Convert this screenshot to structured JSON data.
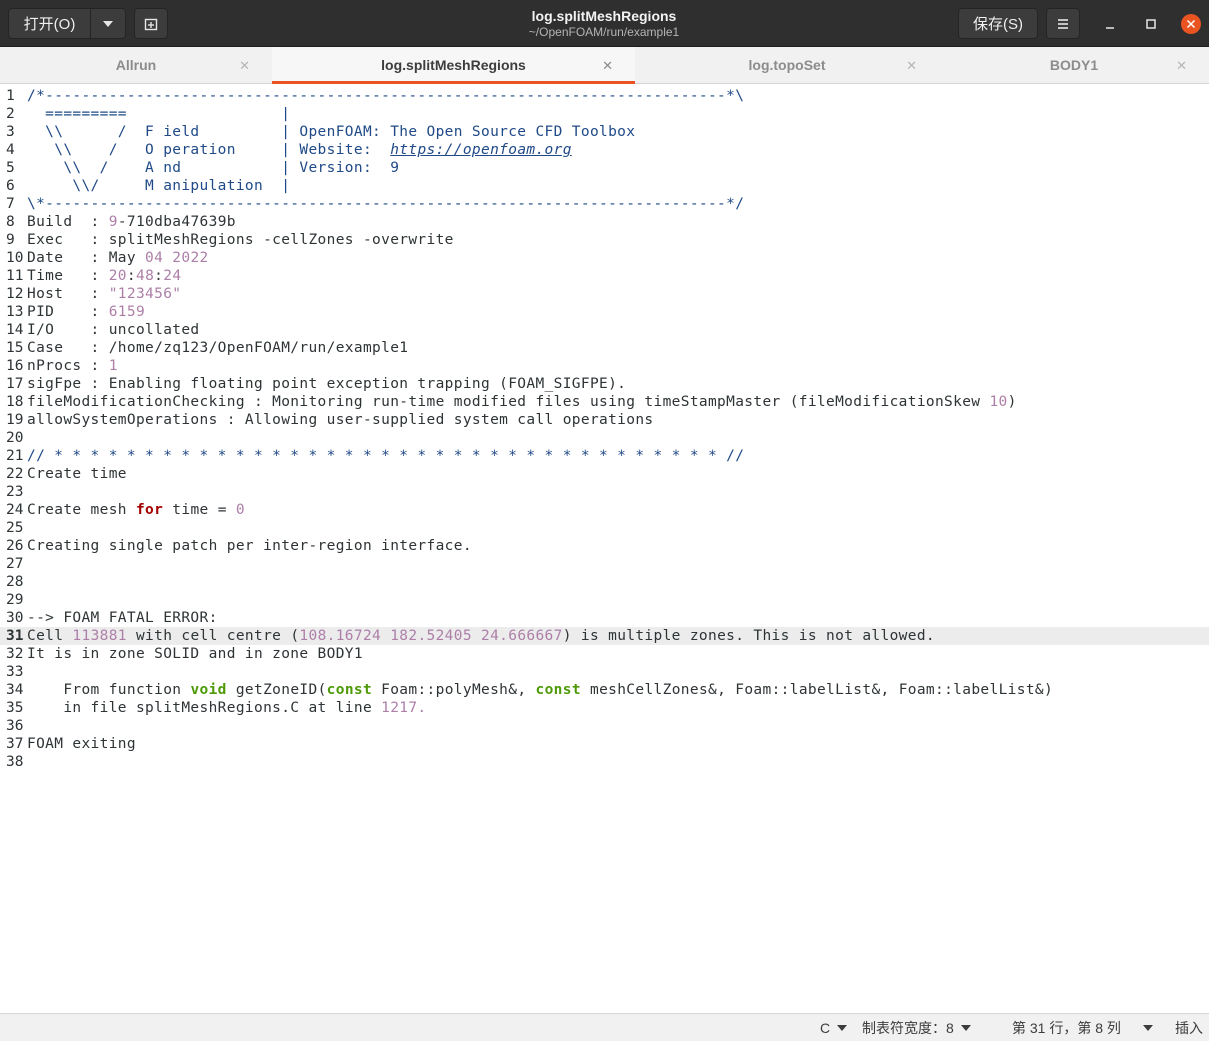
{
  "header": {
    "open_label": "打开(O)",
    "title": "log.splitMeshRegions",
    "subtitle": "~/OpenFOAM/run/example1",
    "save_label": "保存(S)"
  },
  "tabs": [
    {
      "label": "Allrun",
      "active": false
    },
    {
      "label": "log.splitMeshRegions",
      "active": true
    },
    {
      "label": "log.topoSet",
      "active": false
    },
    {
      "label": "BODY1",
      "active": false
    }
  ],
  "editor": {
    "current_line": 31,
    "lines": [
      [
        [
          "/*---------------------------------------------------------------------------*\\",
          "cm"
        ]
      ],
      [
        [
          "  =========                 |",
          "cm"
        ]
      ],
      [
        [
          "  \\\\      /  F ield         | OpenFOAM: The Open Source CFD Toolbox",
          "cm"
        ]
      ],
      [
        [
          "   \\\\    /   O peration     | Website:  ",
          "cm"
        ],
        [
          "https://openfoam.org",
          "url"
        ]
      ],
      [
        [
          "    \\\\  /    A nd           | Version:  9",
          "cm"
        ]
      ],
      [
        [
          "     \\\\/     M anipulation  |",
          "cm"
        ]
      ],
      [
        [
          "\\*---------------------------------------------------------------------------*/",
          "cm"
        ]
      ],
      [
        [
          "Build  : ",
          ""
        ],
        [
          "9",
          "nm"
        ],
        [
          "-710dba47639b",
          ""
        ]
      ],
      [
        [
          "Exec   : splitMeshRegions -cellZones -overwrite",
          ""
        ]
      ],
      [
        [
          "Date   : May ",
          ""
        ],
        [
          "04 2022",
          "nm"
        ]
      ],
      [
        [
          "Time   : ",
          ""
        ],
        [
          "20",
          "nm"
        ],
        [
          ":",
          ""
        ],
        [
          "48",
          "nm"
        ],
        [
          ":",
          ""
        ],
        [
          "24",
          "nm"
        ]
      ],
      [
        [
          "Host   : ",
          ""
        ],
        [
          "\"123456\"",
          "nm"
        ]
      ],
      [
        [
          "PID    : ",
          ""
        ],
        [
          "6159",
          "nm"
        ]
      ],
      [
        [
          "I/O    : uncollated",
          ""
        ]
      ],
      [
        [
          "Case   : /home/zq123/OpenFOAM/run/example1",
          ""
        ]
      ],
      [
        [
          "nProcs : ",
          ""
        ],
        [
          "1",
          "nm"
        ]
      ],
      [
        [
          "sigFpe : Enabling floating point exception trapping (FOAM_SIGFPE).",
          ""
        ]
      ],
      [
        [
          "fileModificationChecking : Monitoring run-time modified files using timeStampMaster (fileModificationSkew ",
          ""
        ],
        [
          "10",
          "nm"
        ],
        [
          ")",
          ""
        ]
      ],
      [
        [
          "allowSystemOperations : Allowing user-supplied system call operations",
          ""
        ]
      ],
      [],
      [
        [
          "// * * * * * * * * * * * * * * * * * * * * * * * * * * * * * * * * * * * * * //",
          "cm"
        ]
      ],
      [
        [
          "Create time",
          ""
        ]
      ],
      [],
      [
        [
          "Create mesh ",
          ""
        ],
        [
          "for",
          "kw"
        ],
        [
          " time = ",
          ""
        ],
        [
          "0",
          "nm"
        ]
      ],
      [],
      [
        [
          "Creating single patch per inter-region interface.",
          ""
        ]
      ],
      [],
      [],
      [],
      [
        [
          "--> FOAM FATAL ERROR:",
          ""
        ]
      ],
      [
        [
          "Cell ",
          ""
        ],
        [
          "113881",
          "nm"
        ],
        [
          " with cell centre (",
          ""
        ],
        [
          "108.16724 182.52405 24.666667",
          "nm"
        ],
        [
          ") is multiple zones. This is not allowed.",
          ""
        ]
      ],
      [
        [
          "It is in zone SOLID and in zone BODY1",
          ""
        ]
      ],
      [],
      [
        [
          "    From function ",
          ""
        ],
        [
          "void",
          "ty"
        ],
        [
          " getZoneID(",
          ""
        ],
        [
          "const",
          "ty"
        ],
        [
          " Foam::polyMesh&, ",
          ""
        ],
        [
          "const",
          "ty"
        ],
        [
          " meshCellZones&, Foam::labelList&, Foam::labelList&)",
          ""
        ]
      ],
      [
        [
          "    in file splitMeshRegions.C at line ",
          ""
        ],
        [
          "1217.",
          "nm"
        ]
      ],
      [],
      [
        [
          "FOAM exiting",
          ""
        ]
      ],
      []
    ]
  },
  "status": {
    "language": "C",
    "tab_width": "制表符宽度：8",
    "position": "第 31 行，第 8 列",
    "mode": "插入"
  }
}
